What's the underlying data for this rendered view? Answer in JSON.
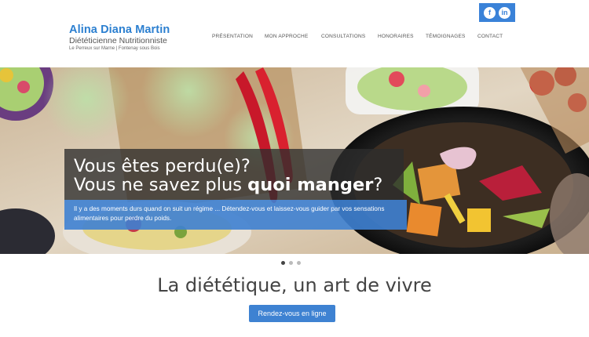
{
  "brand": {
    "name": "Alina Diana Martin",
    "subtitle": "Diététicienne Nutritionniste",
    "location": "Le Perreux sur Marne | Fontenay sous Bois"
  },
  "social": {
    "facebook": "f",
    "linkedin": "in"
  },
  "nav": {
    "items": [
      "PRÉSENTATION",
      "MON APPROCHE",
      "CONSULTATIONS",
      "HONORAIRES",
      "TÉMOIGNAGES",
      "CONTACT"
    ]
  },
  "hero": {
    "title_line1": "Vous êtes perdu(e)?",
    "title_line2_prefix": "Vous ne savez plus ",
    "title_line2_bold": "quoi manger",
    "title_line2_suffix": "?",
    "text": "Il y a des moments durs quand on suit un régime ... Détendez-vous et laissez-vous guider par vos sensations alimentaires pour perdre du poids."
  },
  "carousel": {
    "active_index": 0,
    "count": 3
  },
  "main": {
    "tagline": "La diététique, un art de vivre",
    "cta_label": "Rendez-vous en ligne"
  },
  "colors": {
    "accent": "#2b7fd0",
    "cta": "#3e82d2"
  },
  "icons": [
    "facebook-icon",
    "linkedin-icon"
  ]
}
